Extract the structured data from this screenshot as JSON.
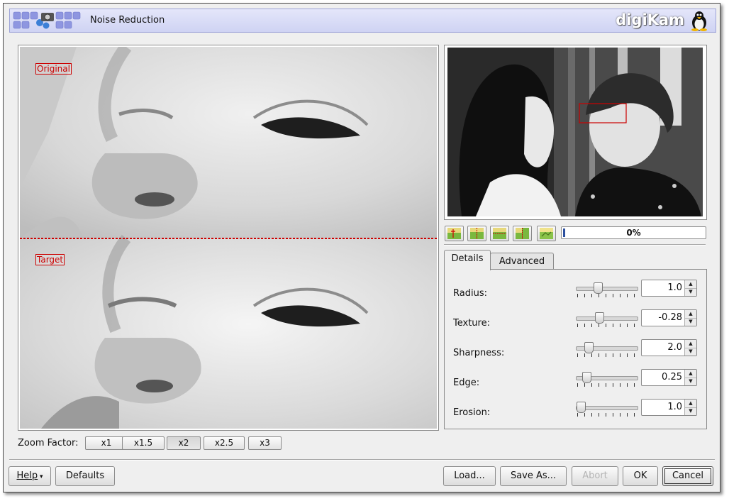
{
  "window": {
    "title": "Noise Reduction",
    "brand": "digiKam"
  },
  "preview": {
    "original_label": "Original",
    "target_label": "Target"
  },
  "zoom": {
    "label": "Zoom Factor:",
    "options": [
      "x1",
      "x1.5",
      "x2",
      "x2.5",
      "x3"
    ],
    "selected": "x2"
  },
  "progress": {
    "value": 0,
    "text": "0%"
  },
  "tools": [
    "original-image-icon",
    "split-vertical-icon",
    "split-horizontal-icon",
    "split-mirror-icon",
    "target-image-icon"
  ],
  "tabs": [
    {
      "label": "Details",
      "active": true
    },
    {
      "label": "Advanced",
      "active": false
    }
  ],
  "details": {
    "params": [
      {
        "label": "Radius:",
        "value": "1.0"
      },
      {
        "label": "Texture:",
        "value": "-0.28"
      },
      {
        "label": "Sharpness:",
        "value": "2.0"
      },
      {
        "label": "Edge:",
        "value": "0.25"
      },
      {
        "label": "Erosion:",
        "value": "1.0"
      }
    ]
  },
  "buttons": {
    "help": "Help",
    "defaults": "Defaults",
    "load": "Load...",
    "save_as": "Save As...",
    "abort": "Abort",
    "ok": "OK",
    "cancel": "Cancel"
  },
  "colors": {
    "banner": "#d7daf6",
    "marker": "#cc0000",
    "progress": "#2c4f9e"
  }
}
